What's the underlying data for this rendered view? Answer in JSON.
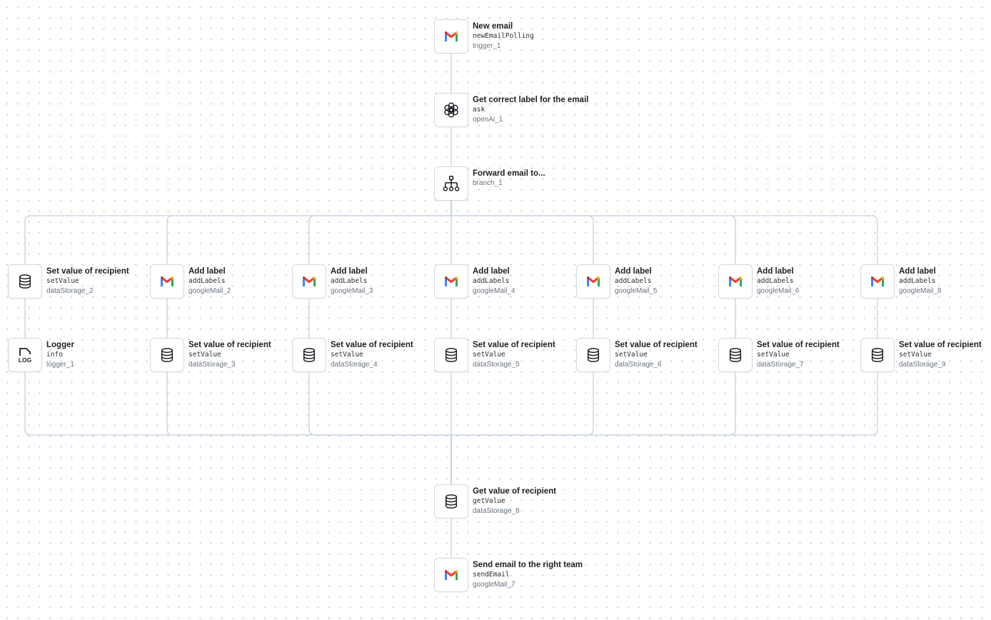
{
  "colors": {
    "wire": "#c5d1e2",
    "gmail_red": "#ea4335",
    "gmail_blue": "#4285f4",
    "gmail_green": "#34a853",
    "gmail_yellow": "#fbbc04",
    "gmail_darkred": "#c5221f"
  },
  "nodes": [
    {
      "key": "trigger_1",
      "icon": "gmail-icon",
      "title": "New email",
      "method": "newEmailPolling",
      "id": "trigger_1"
    },
    {
      "key": "openAi_1",
      "icon": "openai-icon",
      "title": "Get correct label for the email",
      "method": "ask",
      "id": "openAi_1"
    },
    {
      "key": "branch_1",
      "icon": "branch-icon",
      "title": "Forward email to...",
      "method": "",
      "id": "branch_1"
    },
    {
      "key": "dataStorage_2",
      "icon": "database-icon",
      "title": "Set value of recipient",
      "method": "setValue",
      "id": "dataStorage_2"
    },
    {
      "key": "googleMail_2",
      "icon": "gmail-icon",
      "title": "Add label",
      "method": "addLabels",
      "id": "googleMail_2"
    },
    {
      "key": "googleMail_3",
      "icon": "gmail-icon",
      "title": "Add label",
      "method": "addLabels",
      "id": "googleMail_3"
    },
    {
      "key": "googleMail_4",
      "icon": "gmail-icon",
      "title": "Add label",
      "method": "addLabels",
      "id": "googleMail_4"
    },
    {
      "key": "googleMail_5",
      "icon": "gmail-icon",
      "title": "Add label",
      "method": "addLabels",
      "id": "googleMail_5"
    },
    {
      "key": "googleMail_6",
      "icon": "gmail-icon",
      "title": "Add label",
      "method": "addLabels",
      "id": "googleMail_6"
    },
    {
      "key": "googleMail_8",
      "icon": "gmail-icon",
      "title": "Add label",
      "method": "addLabels",
      "id": "googleMail_8"
    },
    {
      "key": "logger_1",
      "icon": "log-icon",
      "title": "Logger",
      "method": "info",
      "id": "logger_1"
    },
    {
      "key": "dataStorage_3",
      "icon": "database-icon",
      "title": "Set value of recipient",
      "method": "setValue",
      "id": "dataStorage_3"
    },
    {
      "key": "dataStorage_4",
      "icon": "database-icon",
      "title": "Set value of recipient",
      "method": "setValue",
      "id": "dataStorage_4"
    },
    {
      "key": "dataStorage_5",
      "icon": "database-icon",
      "title": "Set value of recipient",
      "method": "setValue",
      "id": "dataStorage_5"
    },
    {
      "key": "dataStorage_6",
      "icon": "database-icon",
      "title": "Set value of recipient",
      "method": "setValue",
      "id": "dataStorage_6"
    },
    {
      "key": "dataStorage_7",
      "icon": "database-icon",
      "title": "Set value of recipient",
      "method": "setValue",
      "id": "dataStorage_7"
    },
    {
      "key": "dataStorage_9",
      "icon": "database-icon",
      "title": "Set value of recipient",
      "method": "setValue",
      "id": "dataStorage_9"
    },
    {
      "key": "dataStorage_8",
      "icon": "database-icon",
      "title": "Get value of recipient",
      "method": "getValue",
      "id": "dataStorage_8"
    },
    {
      "key": "googleMail_7",
      "icon": "gmail-icon",
      "title": "Send email to the right team",
      "method": "sendEmail",
      "id": "googleMail_7"
    }
  ],
  "edges": [
    [
      "trigger_1",
      "openAi_1"
    ],
    [
      "openAi_1",
      "branch_1"
    ],
    [
      "branch_1",
      "dataStorage_2"
    ],
    [
      "branch_1",
      "googleMail_2"
    ],
    [
      "branch_1",
      "googleMail_3"
    ],
    [
      "branch_1",
      "googleMail_4"
    ],
    [
      "branch_1",
      "googleMail_5"
    ],
    [
      "branch_1",
      "googleMail_6"
    ],
    [
      "branch_1",
      "googleMail_8"
    ],
    [
      "dataStorage_2",
      "logger_1"
    ],
    [
      "googleMail_2",
      "dataStorage_3"
    ],
    [
      "googleMail_3",
      "dataStorage_4"
    ],
    [
      "googleMail_4",
      "dataStorage_5"
    ],
    [
      "googleMail_5",
      "dataStorage_6"
    ],
    [
      "googleMail_6",
      "dataStorage_7"
    ],
    [
      "googleMail_8",
      "dataStorage_9"
    ],
    [
      "logger_1",
      "dataStorage_8"
    ],
    [
      "dataStorage_3",
      "dataStorage_8"
    ],
    [
      "dataStorage_4",
      "dataStorage_8"
    ],
    [
      "dataStorage_5",
      "dataStorage_8"
    ],
    [
      "dataStorage_6",
      "dataStorage_8"
    ],
    [
      "dataStorage_7",
      "dataStorage_8"
    ],
    [
      "dataStorage_9",
      "dataStorage_8"
    ],
    [
      "dataStorage_8",
      "googleMail_7"
    ]
  ]
}
